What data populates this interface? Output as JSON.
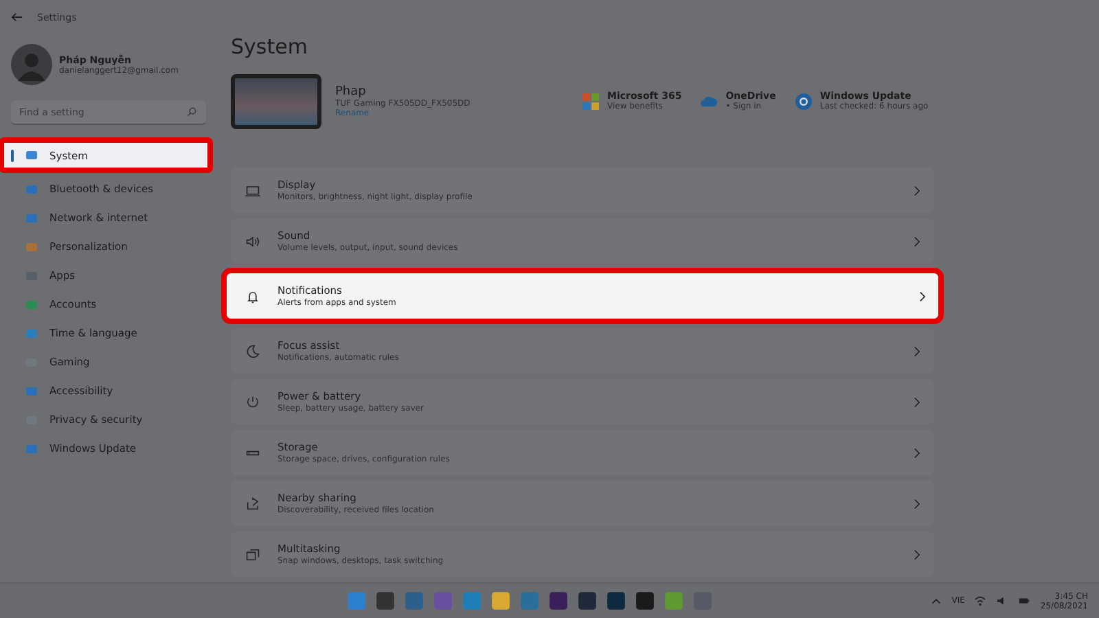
{
  "window": {
    "title": "Settings"
  },
  "profile": {
    "name": "Pháp Nguyễn",
    "email": "danielanggert12@gmail.com"
  },
  "search": {
    "placeholder": "Find a setting"
  },
  "sidebar": {
    "items": [
      {
        "label": "System",
        "selected": true,
        "highlighted": true
      },
      {
        "label": "Bluetooth & devices",
        "selected": false,
        "highlighted": false
      },
      {
        "label": "Network & internet",
        "selected": false,
        "highlighted": false
      },
      {
        "label": "Personalization",
        "selected": false,
        "highlighted": false
      },
      {
        "label": "Apps",
        "selected": false,
        "highlighted": false
      },
      {
        "label": "Accounts",
        "selected": false,
        "highlighted": false
      },
      {
        "label": "Time & language",
        "selected": false,
        "highlighted": false
      },
      {
        "label": "Gaming",
        "selected": false,
        "highlighted": false
      },
      {
        "label": "Accessibility",
        "selected": false,
        "highlighted": false
      },
      {
        "label": "Privacy & security",
        "selected": false,
        "highlighted": false
      },
      {
        "label": "Windows Update",
        "selected": false,
        "highlighted": false
      }
    ]
  },
  "page_title": "System",
  "device": {
    "name": "Phap",
    "model": "TUF Gaming FX505DD_FX505DD",
    "rename": "Rename"
  },
  "services": [
    {
      "title": "Microsoft 365",
      "subtitle": "View benefits"
    },
    {
      "title": "OneDrive",
      "subtitle": "• Sign in"
    },
    {
      "title": "Windows Update",
      "subtitle": "Last checked: 6 hours ago"
    }
  ],
  "settings": [
    {
      "title": "Display",
      "subtitle": "Monitors, brightness, night light, display profile",
      "highlighted": false
    },
    {
      "title": "Sound",
      "subtitle": "Volume levels, output, input, sound devices",
      "highlighted": false
    },
    {
      "title": "Notifications",
      "subtitle": "Alerts from apps and system",
      "highlighted": true
    },
    {
      "title": "Focus assist",
      "subtitle": "Notifications, automatic rules",
      "highlighted": false
    },
    {
      "title": "Power & battery",
      "subtitle": "Sleep, battery usage, battery saver",
      "highlighted": false
    },
    {
      "title": "Storage",
      "subtitle": "Storage space, drives, configuration rules",
      "highlighted": false
    },
    {
      "title": "Nearby sharing",
      "subtitle": "Discoverability, received files location",
      "highlighted": false
    },
    {
      "title": "Multitasking",
      "subtitle": "Snap windows, desktops, task switching",
      "highlighted": false
    }
  ],
  "taskbar": {
    "language": "VIE",
    "time": "3:45 CH",
    "date": "25/08/2021"
  }
}
